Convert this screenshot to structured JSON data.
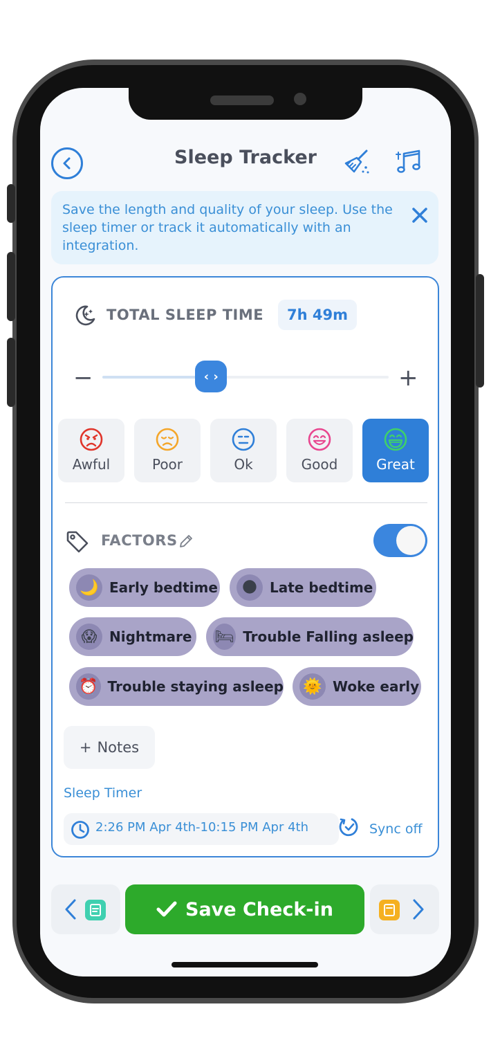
{
  "header": {
    "title": "Sleep Tracker",
    "back_icon": "chevron-left-icon",
    "broom_icon": "broom-icon",
    "music_icon": "music-notes-icon"
  },
  "info_banner": {
    "text": "Save the length and quality of your sleep. Use the sleep timer or track it automatically with an integration.",
    "close_icon": "close-icon"
  },
  "total_sleep": {
    "label": "TOTAL SLEEP TIME",
    "value": "7h 49m",
    "slider_fraction": 0.38,
    "minus": "−",
    "plus": "+"
  },
  "moods": [
    {
      "label": "Awful",
      "color": "#e0352b",
      "selected": false
    },
    {
      "label": "Poor",
      "color": "#f4a62a",
      "selected": false
    },
    {
      "label": "Ok",
      "color": "#2f7fd8",
      "selected": false
    },
    {
      "label": "Good",
      "color": "#e8468f",
      "selected": false
    },
    {
      "label": "Great",
      "color": "#3fd06a",
      "selected": true
    }
  ],
  "factors": {
    "label": "FACTORS",
    "toggle_on": true,
    "chips": [
      {
        "emoji": "🌙",
        "label": "Early bedtime"
      },
      {
        "emoji": "🌑",
        "label": "Late bedtime"
      },
      {
        "emoji": "😱",
        "label": "Nightmare"
      },
      {
        "emoji": "🛏",
        "label": "Trouble Falling asleep"
      },
      {
        "emoji": "⏰",
        "label": "Trouble staying asleep"
      },
      {
        "emoji": "🌞",
        "label": "Woke early"
      }
    ]
  },
  "notes": {
    "label": "Notes",
    "plus": "+"
  },
  "sleep_timer": {
    "label": "Sleep Timer",
    "range": "2:26 PM Apr 4th-10:15 PM Apr 4th",
    "sync_label": "Sync off"
  },
  "bottom_bar": {
    "save_label": "Save Check-in",
    "prev_icon": "chevron-left-icon",
    "next_icon": "chevron-right-icon"
  },
  "colors": {
    "accent": "#2f7fd8",
    "save": "#2daa2b",
    "chip": "#a9a4c8"
  }
}
